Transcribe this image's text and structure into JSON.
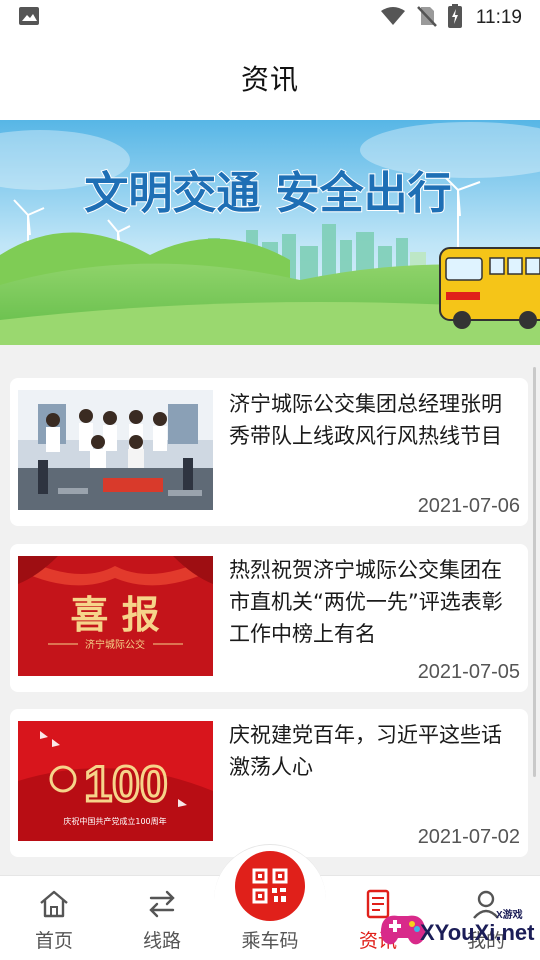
{
  "status_bar": {
    "time": "11:19",
    "icons": [
      "image-notification-icon",
      "wifi-icon",
      "no-sim-icon",
      "battery-charging-icon"
    ]
  },
  "header": {
    "title": "资讯"
  },
  "banner": {
    "headline": "文明交通  安全出行"
  },
  "news": [
    {
      "title": "济宁城际公交集团总经理张明秀带队上线政风行风热线节目",
      "date": "2021-07-06",
      "thumb": "radio-studio-photo"
    },
    {
      "title": "热烈祝贺济宁城际公交集团在市直机关“两优一先”评选表彰工作中榜上有名",
      "date": "2021-07-05",
      "thumb_text": "喜 报",
      "thumb_sub": "济宁城际公交"
    },
    {
      "title": "庆祝建党百年，习近平这些话激荡人心",
      "date": "2021-07-02",
      "thumb_text": "100",
      "thumb_sub": "庆祝中国共产党成立100周年"
    }
  ],
  "bottom_nav": {
    "items": [
      {
        "label": "首页",
        "icon": "home-icon"
      },
      {
        "label": "线路",
        "icon": "route-swap-icon"
      },
      {
        "label": "乘车码",
        "icon": "qr-code-icon"
      },
      {
        "label": "资讯",
        "icon": "news-icon",
        "active": true
      },
      {
        "label": "我的",
        "icon": "profile-icon"
      }
    ]
  },
  "watermark": {
    "text": "XYouXi.net",
    "small": "X游戏"
  },
  "colors": {
    "accent": "#e0201a",
    "feed_bg": "#f1f1f1"
  }
}
